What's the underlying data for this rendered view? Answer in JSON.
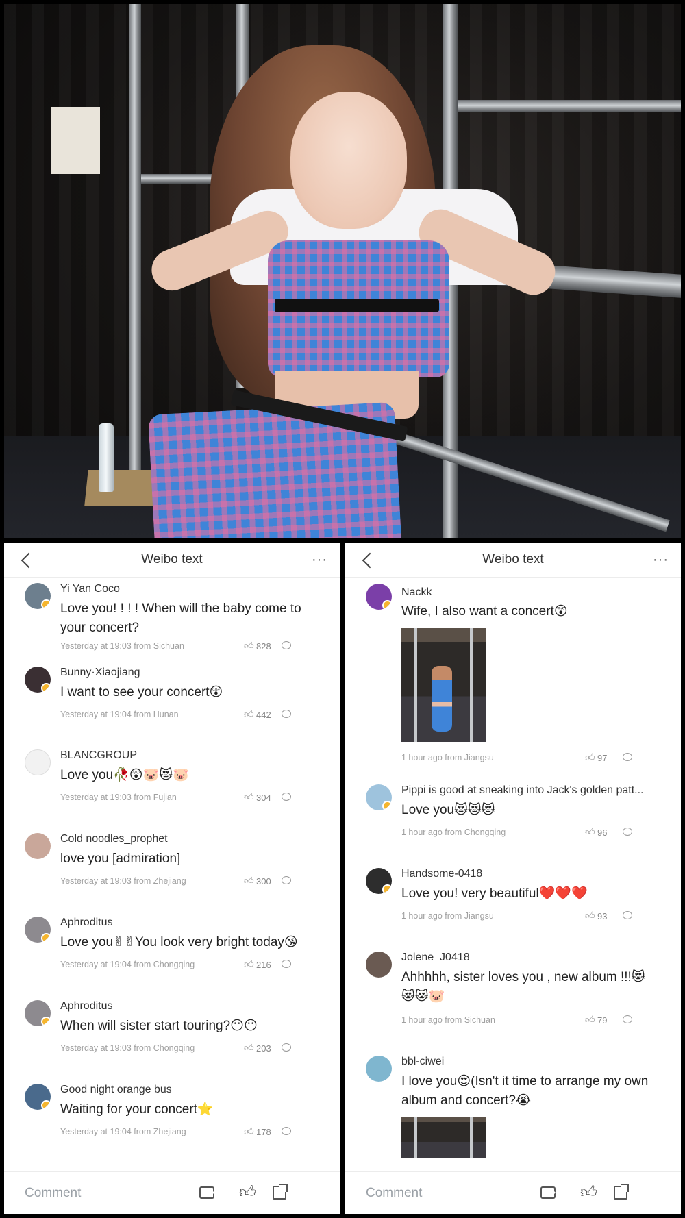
{
  "left_panel": {
    "title": "Weibo text",
    "more": "···",
    "comments": [
      {
        "user": "Yi Yan Coco",
        "text": "Love you! ! ! ! When will the baby come to your concert?",
        "meta": "Yesterday at 19:03 from Sichuan",
        "likes": "828",
        "avatar_color": "#6d7f8e"
      },
      {
        "user": "Bunny·Xiaojiang",
        "text": "I want to see your concert😲",
        "meta": "Yesterday at 19:04 from Hunan",
        "likes": "442",
        "avatar_color": "#3a2f33"
      },
      {
        "user": "BLANCGROUP",
        "text": "Love you🥀😲🐷😻🐷",
        "meta": "Yesterday at 19:03 from Fujian",
        "likes": "304",
        "avatar_color": "#f2f2f2"
      },
      {
        "user": "Cold noodles_prophet",
        "text": "love you [admiration]",
        "meta": "Yesterday at 19:03 from Zhejiang",
        "likes": "300",
        "avatar_color": "#c9a79a"
      },
      {
        "user": "Aphroditus",
        "text": "Love you✌✌You look very bright today😘",
        "meta": "Yesterday at 19:04 from Chongqing",
        "likes": "216",
        "avatar_color": "#8d8a8f"
      },
      {
        "user": "Aphroditus",
        "text": "When will sister start touring?😶😶",
        "meta": "Yesterday at 19:03 from Chongqing",
        "likes": "203",
        "avatar_color": "#8d8a8f"
      },
      {
        "user": "Good night orange bus",
        "text": "Waiting for your concert⭐",
        "meta": "Yesterday at 19:04 from Zhejiang",
        "likes": "178",
        "avatar_color": "#4a6a8c"
      }
    ],
    "bottom": {
      "comment_placeholder": "Comment"
    }
  },
  "right_panel": {
    "title": "Weibo text",
    "more": "···",
    "comments": [
      {
        "user": "Nackk",
        "text": "Wife, I also want a concert😲",
        "meta": "1 hour ago from Jiangsu",
        "likes": "97",
        "avatar_color": "#7b3fa8"
      },
      {
        "user": "Pippi is good at sneaking into Jack's golden patt...",
        "text": "Love you😻😻😻",
        "meta": "1 hour ago from Chongqing",
        "likes": "96",
        "avatar_color": "#9ec3dd"
      },
      {
        "user": "Handsome-0418",
        "text": "Love you! very beautiful❤️❤️❤️",
        "meta": "1 hour ago from Jiangsu",
        "likes": "93",
        "avatar_color": "#2d2d2d"
      },
      {
        "user": "Jolene_J0418",
        "text": "Ahhhhh, sister loves you , new album !!!😻😻😻🐷",
        "meta": "1 hour ago from Sichuan",
        "likes": "79",
        "avatar_color": "#6a5a52"
      },
      {
        "user": "bbl-ciwei",
        "text": "I love you😍(Isn't it time to arrange my own album and concert?😭",
        "meta": "",
        "likes": "",
        "avatar_color": "#7fb6cf"
      }
    ],
    "bottom": {
      "comment_placeholder": "Comment"
    }
  }
}
